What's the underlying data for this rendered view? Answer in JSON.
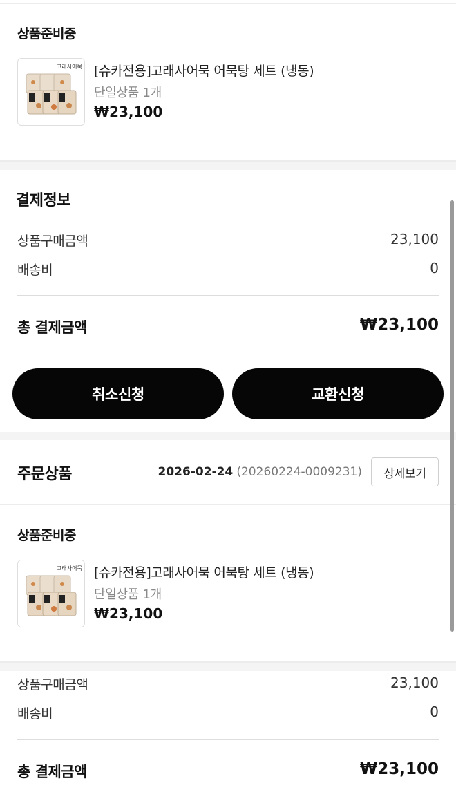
{
  "product_block_1": {
    "status": "상품준비중",
    "product": {
      "name": "[슈카전용]고래사어묵 어묵탕 세트 (냉동)",
      "option": "단일상품 1개",
      "price": "₩23,100",
      "thumbnail_icon": "fishcake-package-image"
    }
  },
  "payment": {
    "title": "결제정보",
    "rows": [
      {
        "label": "상품구매금액",
        "value": "23,100"
      },
      {
        "label": "배송비",
        "value": "0"
      }
    ],
    "total_label": "총 결제금액",
    "total_value": "₩23,100"
  },
  "actions": {
    "cancel_label": "취소신청",
    "exchange_label": "교환신청"
  },
  "order_products": {
    "title": "주문상품",
    "date": "2026-02-24",
    "order_number": "(20260224-0009231)",
    "detail_button": "상세보기"
  },
  "product_block_2": {
    "status": "상품준비중",
    "product": {
      "name": "[슈카전용]고래사어묵 어묵탕 세트 (냉동)",
      "option": "단일상품 1개",
      "price": "₩23,100",
      "thumbnail_icon": "fishcake-package-image"
    }
  },
  "payment_2": {
    "rows": [
      {
        "label": "상품구매금액",
        "value": "23,100"
      },
      {
        "label": "배송비",
        "value": "0"
      }
    ],
    "total_label": "총 결제금액",
    "total_value": "₩23,100"
  },
  "colors": {
    "button_bg": "#060606",
    "button_text": "#ffffff",
    "muted_text": "#8a8a8a",
    "separator_band": "#f4f4f4"
  }
}
